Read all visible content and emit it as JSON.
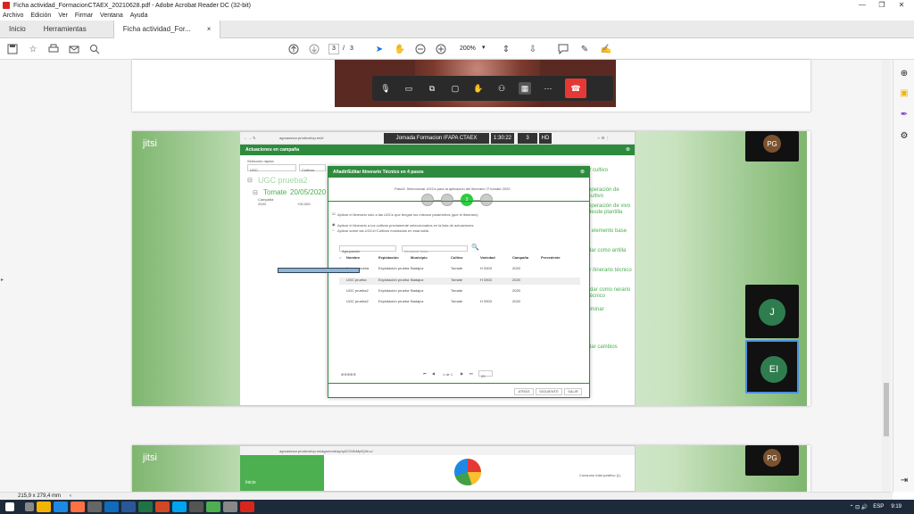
{
  "window": {
    "title": "Ficha actividad_FormacionCTAEX_20210628.pdf - Adobe Acrobat Reader DC (32-bit)"
  },
  "menu": [
    "Archivo",
    "Edición",
    "Ver",
    "Firmar",
    "Ventana",
    "Ayuda"
  ],
  "tabs": {
    "home": "Inicio",
    "tools": "Herramientas",
    "doc": "Ficha actividad_For...",
    "close": "×"
  },
  "toolbar": {
    "page_current": "3",
    "page_sep": "/",
    "page_total": "3",
    "zoom": "200%"
  },
  "status": {
    "size": "215,9 x 279,4 mm"
  },
  "meeting": {
    "name": "Jornada Formacion IFAPA CTAEX",
    "time": "1:30:22",
    "count": "3",
    "quality": "HD",
    "logo": "jitsi",
    "participants": [
      {
        "initials": "PG"
      },
      {
        "initials": "J"
      },
      {
        "initials": "EI"
      }
    ]
  },
  "browser": {
    "url": "agroasesor.prodevelop.es/#",
    "url2": "agroasesor.prodevelop.es/agro/mrd/ay/q4ZCMfvMpfQ4t=u/",
    "header": "Actuaciones en campaña",
    "filter_label": "Selección rápida",
    "filter_ugc": "UGC",
    "filter_cultivo": "Cultivos",
    "ugc_title": "UGC prueba2",
    "crop_title": "Tomate",
    "crop_date": "20/05/2020",
    "camp_label": "Campaña",
    "camp_value": "2020",
    "ha_value": "+00.000",
    "side_actions": [
      "ir cultivo",
      "operación de cultivo",
      "operación de vivo desde plantilla",
      "r elemento base",
      "dar como antilla",
      "ir itinerario técnico",
      "rdar como nerario técnico",
      "liminar",
      "dar cambios"
    ],
    "bottom_label": "Inicio",
    "bottom_total": "Consumo total positivo (L)"
  },
  "modal": {
    "title": "Añadir/Editar Itinerario Técnico en 4 pasos",
    "step_text": "Paso3: Seleccionar UGCs para la aplicación del itinerario IT tomate 2020",
    "step_active": "3",
    "opt1": "Aplicar el itinerario sólo a las UGCs que tengan los mismos parámetros (que el itinerario)",
    "opt2": "Aplicar el itinerario a los cultivos previamente seleccionados en la lista de actuaciones",
    "opt3": "Aplicar sobre las UGCs+Cultivos mostrados en esta tabla",
    "group_label": "Agrupación",
    "search_placeholder": "Introducir texto",
    "columns": [
      "Nombre",
      "Explotación",
      "Municipio",
      "Cultivo",
      "Variedad",
      "Campaña",
      "Precedente"
    ],
    "rows": [
      [
        "Nueva prueba",
        "Explotación prueba",
        "Badajoz",
        "Tomate",
        "H 3303",
        "2020",
        ""
      ],
      [
        "UGC prueba",
        "Explotación prueba",
        "Badajoz",
        "Tomate",
        "H 3303",
        "2020",
        ""
      ],
      [
        "UGC prueba2",
        "Explotación prueba",
        "Badajoz",
        "Tomate",
        "",
        "2020",
        ""
      ],
      [
        "UGC prueba2",
        "Explotación prueba",
        "Badajoz",
        "Tomate",
        "H 3303",
        "2020",
        ""
      ]
    ],
    "pager_text": "1 de 1",
    "page_size": "20",
    "btn_back": "ATRÁS",
    "btn_next": "SIGUIENTE",
    "btn_exit": "SALIR"
  },
  "taskbar": {
    "lang": "ESP",
    "time": "9:19"
  },
  "colors": {
    "green": "#2e8b3d",
    "accent": "#4caf50",
    "hangup": "#e53935"
  }
}
